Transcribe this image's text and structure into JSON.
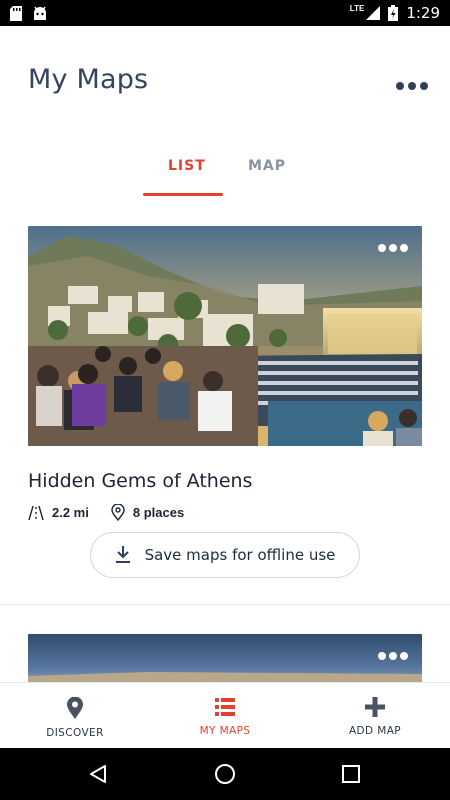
{
  "status_bar": {
    "time": "1:29",
    "network": "LTE"
  },
  "header": {
    "title": "My Maps",
    "menu_icon": "more-horizontal-icon"
  },
  "tabs": [
    {
      "label": "LIST",
      "active": true
    },
    {
      "label": "MAP",
      "active": false
    }
  ],
  "cards": [
    {
      "title": "Hidden Gems of Athens",
      "distance": "2.2 mi",
      "places": "8 places",
      "save_label": "Save maps for offline use"
    }
  ],
  "bottom_nav": [
    {
      "label": "DISCOVER",
      "icon": "map-pin-icon",
      "active": false
    },
    {
      "label": "MY MAPS",
      "icon": "list-icon",
      "active": true
    },
    {
      "label": "ADD MAP",
      "icon": "plus-icon",
      "active": false
    }
  ],
  "colors": {
    "accent": "#e4402e",
    "title": "#34445f",
    "muted": "#8a93a1"
  }
}
